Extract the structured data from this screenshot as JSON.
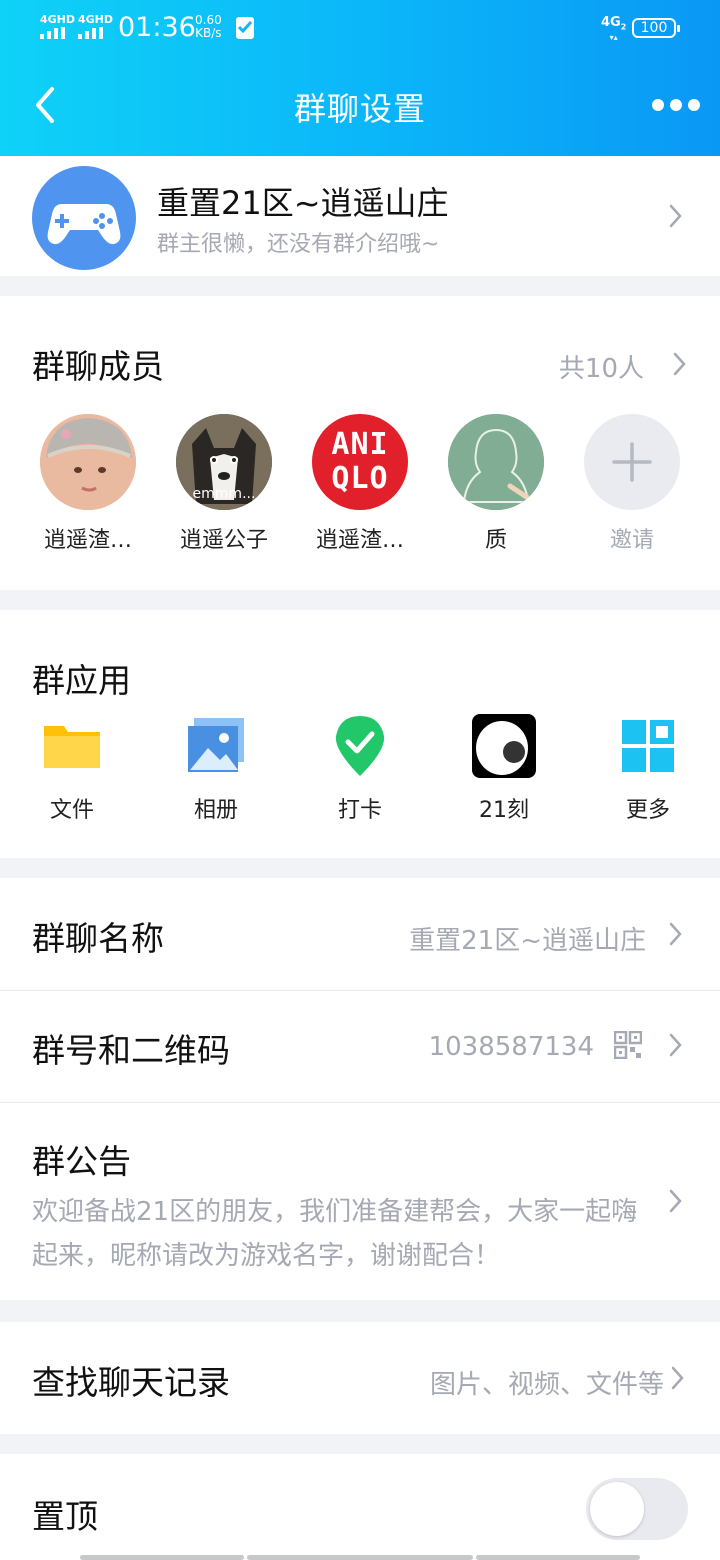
{
  "status_bar": {
    "signal_1": "4GHD",
    "signal_2": "4GHD",
    "time": "01:36",
    "speed_value": "0.60",
    "speed_unit": "KB/s",
    "network": "4G",
    "network_sub": "2",
    "battery": "100"
  },
  "header": {
    "title": "群聊设置"
  },
  "group": {
    "name": "重置21区~逍遥山庄",
    "intro": "群主很懒，还没有群介绍哦~"
  },
  "members": {
    "title": "群聊成员",
    "count": "共10人",
    "items": [
      {
        "name": "逍遥渣…"
      },
      {
        "name": "逍遥公子",
        "avatar_caption": "emmm..."
      },
      {
        "name": "逍遥渣…",
        "avatar_text_1": "ANI",
        "avatar_text_2": "QLO"
      },
      {
        "name": "质"
      }
    ],
    "invite_label": "邀请"
  },
  "apps": {
    "title": "群应用",
    "items": [
      {
        "name": "文件",
        "icon": "folder-icon",
        "color": "#ffc107"
      },
      {
        "name": "相册",
        "icon": "photo-album-icon",
        "color": "#4a90e2"
      },
      {
        "name": "打卡",
        "icon": "check-in-icon",
        "color": "#22c76a"
      },
      {
        "name": "21刻",
        "icon": "eye-icon",
        "color": "#000000"
      },
      {
        "name": "更多",
        "icon": "grid-icon",
        "color": "#1cc3f2"
      }
    ]
  },
  "settings": {
    "group_name_label": "群聊名称",
    "group_name_value": "重置21区~逍遥山庄",
    "group_id_label": "群号和二维码",
    "group_id_value": "1038587134",
    "notice_label": "群公告",
    "notice_text": "欢迎备战21区的朋友，我们准备建帮会，大家一起嗨起来，昵称请改为游戏名字，谢谢配合！",
    "search_label": "查找聊天记录",
    "search_value": "图片、视频、文件等",
    "pin_label": "置顶",
    "pin_enabled": false
  },
  "colors": {
    "header_start": "#0fd2f8",
    "header_end": "#0a98f5",
    "secondary_text": "#a5a9b3",
    "page_bg": "#f2f3f7"
  }
}
